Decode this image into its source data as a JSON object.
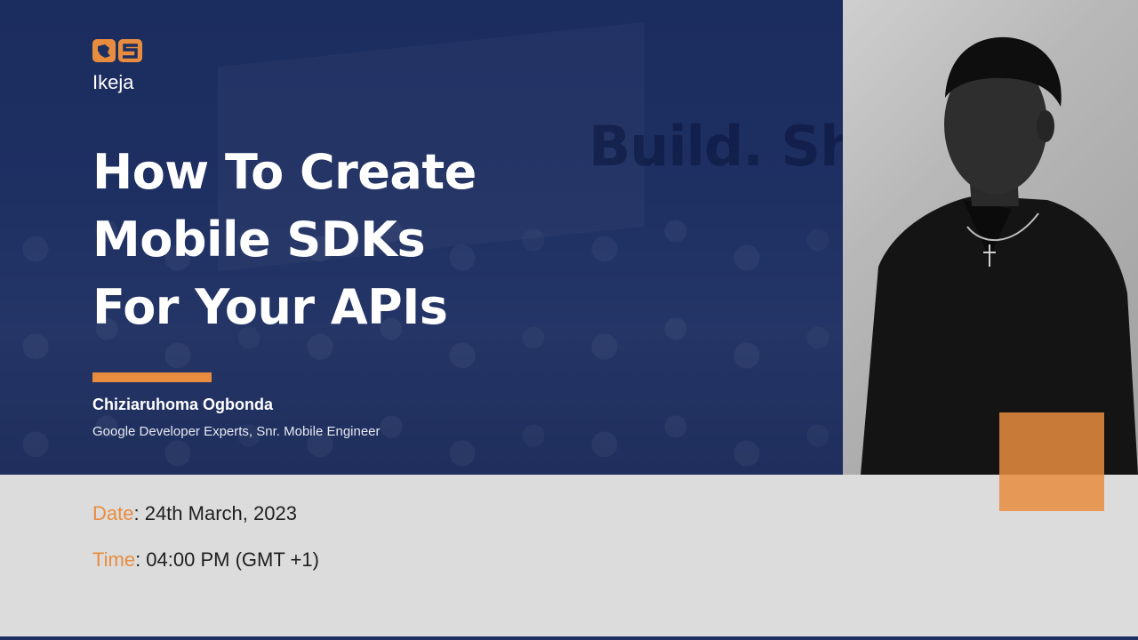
{
  "event": {
    "logo_alt": "OS",
    "location": "Ikeja",
    "background_sign": "Build. Sh"
  },
  "talk": {
    "title_lines": [
      "How To Create",
      "Mobile SDKs",
      "For Your APIs"
    ]
  },
  "speaker": {
    "name": "Chiziaruhoma Ogbonda",
    "role": "Google Developer Experts, Snr. Mobile Engineer"
  },
  "schedule": {
    "date_label": "Date",
    "date_value": ": 24th March, 2023",
    "time_label": "Time",
    "time_value": ": 04:00 PM (GMT +1)"
  },
  "colors": {
    "accent": "#e88c3f",
    "navy": "#1e2f62",
    "footer_bg": "#dcdcdc"
  },
  "icons": [
    "logo-icon"
  ]
}
